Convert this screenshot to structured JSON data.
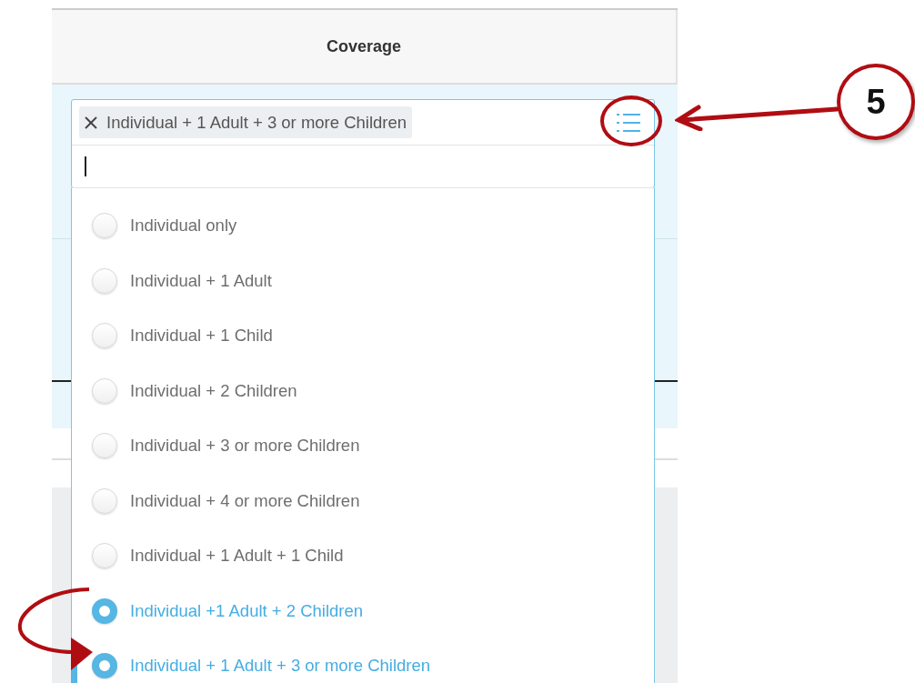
{
  "table": {
    "columns": [
      "Coverage"
    ]
  },
  "coverage_field": {
    "chips": [
      "Individual + 1 Adult + 3 or more Children"
    ],
    "options": [
      {
        "label": "Individual only",
        "selected": false
      },
      {
        "label": "Individual + 1 Adult",
        "selected": false
      },
      {
        "label": "Individual + 1 Child",
        "selected": false
      },
      {
        "label": "Individual + 2 Children",
        "selected": false
      },
      {
        "label": "Individual + 3 or more Children",
        "selected": false
      },
      {
        "label": "Individual + 4 or more Children",
        "selected": false
      },
      {
        "label": "Individual + 1 Adult + 1 Child",
        "selected": false
      },
      {
        "label": "Individual +1 Adult + 2 Children",
        "selected": true
      },
      {
        "label": "Individual + 1 Adult + 3 or more Children",
        "selected": true
      }
    ]
  },
  "annotations": [
    {
      "kind": "callout",
      "label": "5"
    }
  ]
}
